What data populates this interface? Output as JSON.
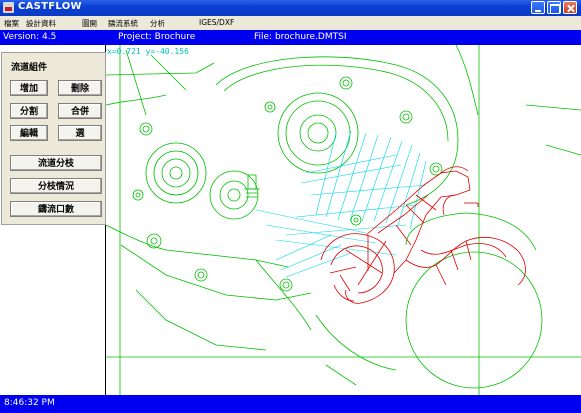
{
  "window": {
    "title": "CASTFLOW"
  },
  "menu": [
    {
      "label": "檔案"
    },
    {
      "label": "設計資料"
    },
    {
      "label": "圖開"
    },
    {
      "label": "鑄流系統"
    },
    {
      "label": "分析"
    },
    {
      "label": "IGES/DXF"
    }
  ],
  "info": {
    "version": "Version: 4.5",
    "project": "Project: Brochure",
    "file": "File: brochure.DMTSI"
  },
  "panel": {
    "title": "流道組件",
    "buttons": {
      "add": "增加",
      "delete": "刪除",
      "split": "分割",
      "merge": "合併",
      "edit": "編輯",
      "select": "選",
      "branch": "流道分枝",
      "branch_status": "分枝情況",
      "gate_count": "鑄流口數"
    }
  },
  "canvas": {
    "cursor_readout": "x=0.721 y=-40.156"
  },
  "status": {
    "time": "8:46:32 PM"
  },
  "colors": {
    "outline": "#00c000",
    "flow": "#00d8e8",
    "runner": "#e00000",
    "bar": "#0000f0"
  }
}
